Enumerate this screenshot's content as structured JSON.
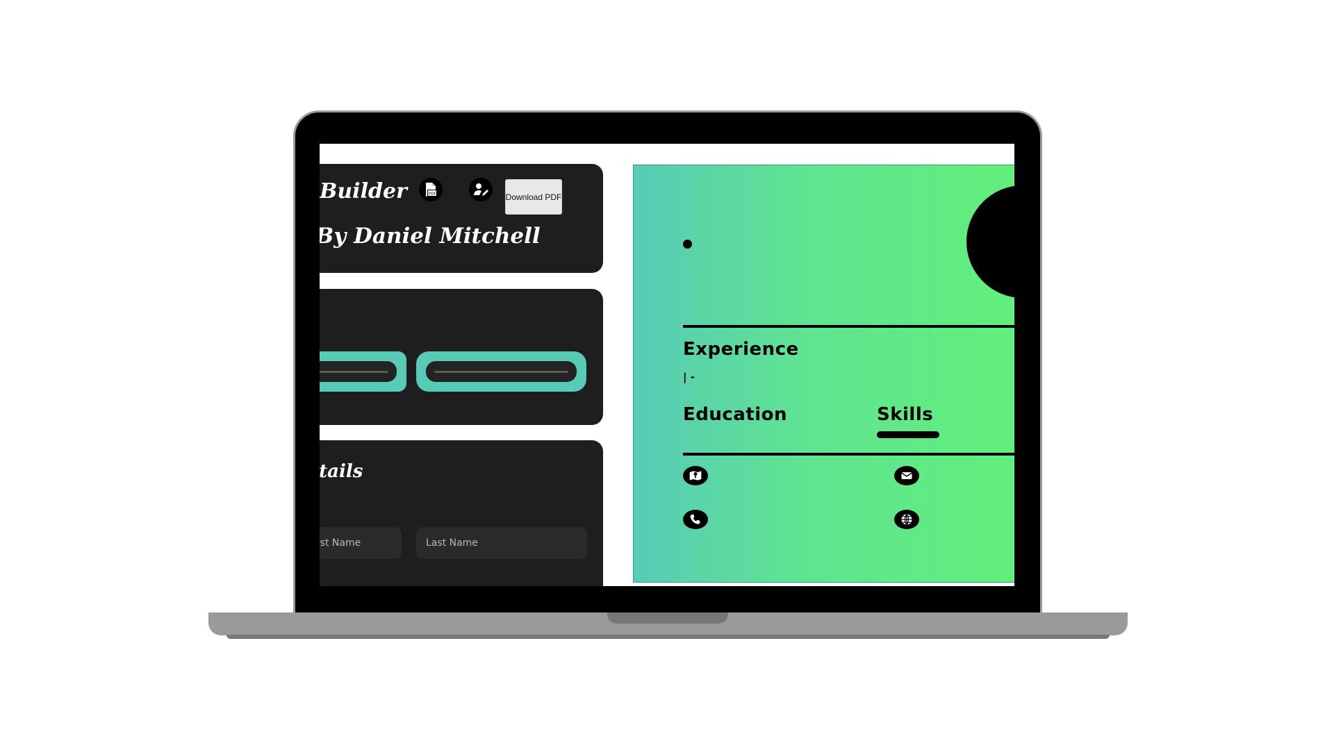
{
  "editor": {
    "app_title": "Builder",
    "author": "By Daniel Mitchell",
    "download_button": "Download PDF",
    "form_section_heading": "Details",
    "first_name_placeholder": "First Name",
    "last_name_placeholder": "Last Name"
  },
  "preview": {
    "experience_heading": "Experience",
    "experience_entry": "| -",
    "education_heading": "Education",
    "skills_heading": "Skills",
    "contact_icons": [
      "map-icon",
      "email-icon",
      "phone-icon",
      "globe-icon"
    ]
  },
  "colors": {
    "panel_bg": "#1e1e1e",
    "accent_teal": "#58cbb6",
    "gradient_start": "#58cbb6",
    "gradient_end": "#62ef7b"
  }
}
